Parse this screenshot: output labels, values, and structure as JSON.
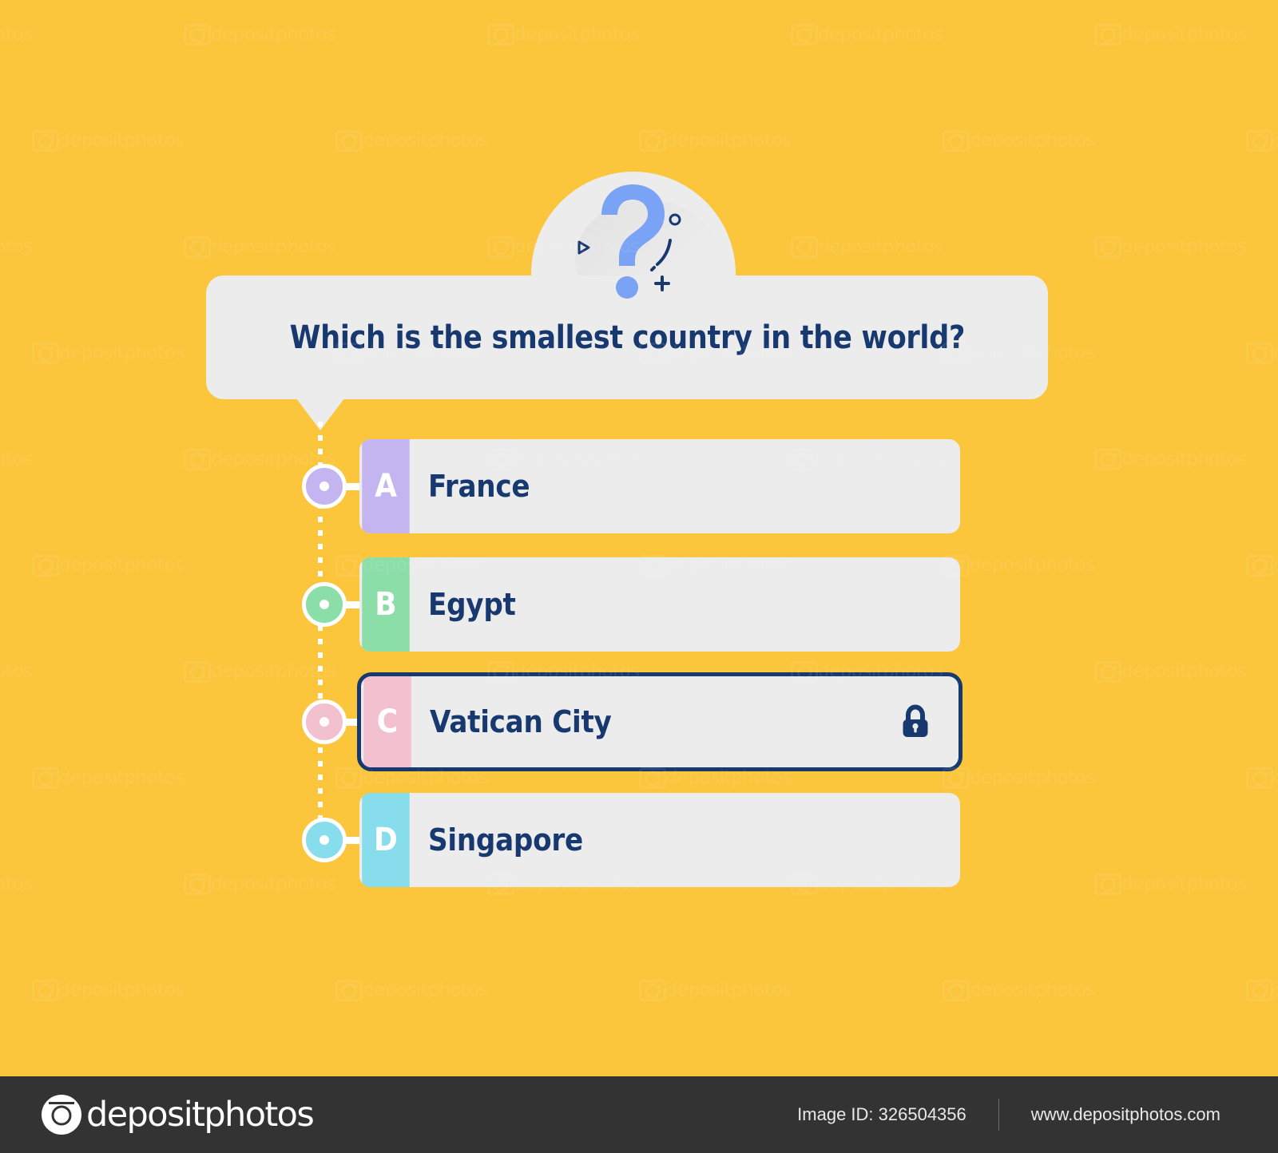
{
  "theme": {
    "background": "#FBC63C",
    "card_surface": "#ECECEC",
    "ink": "#17396F",
    "accent_blue": "#7BA3F5",
    "footer_bg": "#333333"
  },
  "hero": {
    "icon": "question-mark-icon",
    "decorations": [
      "triangle-mark",
      "circle-mark",
      "arc-dash-mark",
      "plus-mark"
    ]
  },
  "question": {
    "text": "Which is the smallest country in the world?"
  },
  "options": [
    {
      "letter": "A",
      "label": "France",
      "color": "#C4B5F0",
      "selected": false,
      "locked": false
    },
    {
      "letter": "B",
      "label": "Egypt",
      "color": "#8CDEA8",
      "selected": false,
      "locked": false
    },
    {
      "letter": "C",
      "label": "Vatican City",
      "color": "#F2C0CE",
      "selected": true,
      "locked": true,
      "lock_icon": "lock-icon"
    },
    {
      "letter": "D",
      "label": "Singapore",
      "color": "#87DDEC",
      "selected": false,
      "locked": false
    }
  ],
  "footer": {
    "wordmark": "depositphotos",
    "logo_icon": "camera-icon",
    "image_id": "Image ID: 326504356",
    "website": "www.depositphotos.com"
  },
  "watermark": {
    "text": "depositphotos",
    "icon": "camera-icon"
  }
}
